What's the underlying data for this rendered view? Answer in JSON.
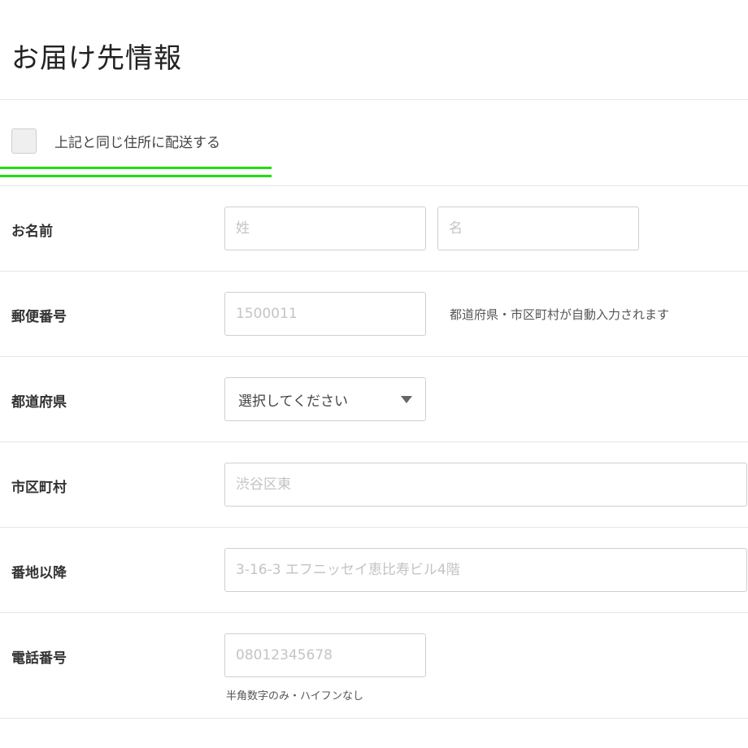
{
  "title": "お届け先情報",
  "same_address": {
    "label": "上記と同じ住所に配送する",
    "checked": false
  },
  "colors": {
    "accent_underline": "#22dd11",
    "border": "#cfcfcf",
    "divider": "#e6e6e6"
  },
  "form": {
    "name": {
      "label": "お名前",
      "last_placeholder": "姓",
      "first_placeholder": "名"
    },
    "postal": {
      "label": "郵便番号",
      "placeholder": "1500011",
      "hint": "都道府県・市区町村が自動入力されます"
    },
    "prefecture": {
      "label": "都道府県",
      "selected": "選択してください",
      "icon": "caret-down-icon"
    },
    "city": {
      "label": "市区町村",
      "placeholder": "渋谷区東"
    },
    "street": {
      "label": "番地以降",
      "placeholder": "3-16-3 エフニッセイ恵比寿ビル4階"
    },
    "phone": {
      "label": "電話番号",
      "placeholder": "08012345678",
      "hint": "半角数字のみ・ハイフンなし"
    }
  }
}
